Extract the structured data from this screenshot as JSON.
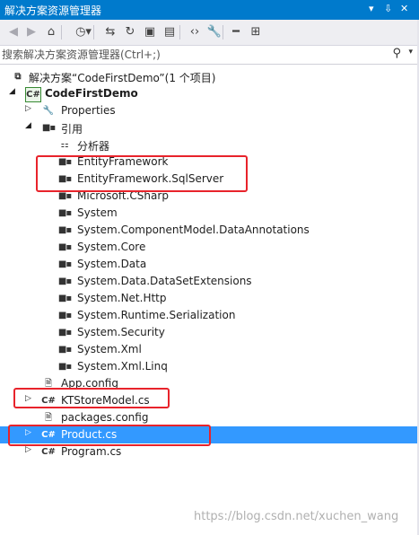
{
  "panel": {
    "title": "解决方案资源管理器",
    "controls": {
      "dropdown": "▾",
      "pin": "⇩",
      "close": "✕"
    }
  },
  "toolbar": {
    "buttons": [
      {
        "name": "back-button",
        "icon": "◀",
        "dim": true
      },
      {
        "name": "forward-button",
        "icon": "▶",
        "dim": true
      },
      {
        "name": "home-button",
        "icon": "⌂"
      },
      {
        "name": "pending-changes-button",
        "icon": "◷▾"
      },
      {
        "name": "sync-button",
        "icon": "⇆"
      },
      {
        "name": "refresh-button",
        "icon": "↻"
      },
      {
        "name": "collapse-all-button",
        "icon": "▣"
      },
      {
        "name": "show-all-files-button",
        "icon": "▤"
      },
      {
        "name": "view-code-button",
        "icon": "‹›"
      },
      {
        "name": "properties-button",
        "icon": "🔧"
      },
      {
        "name": "preview-button",
        "icon": "━"
      },
      {
        "name": "class-diagram-button",
        "icon": "⊞"
      }
    ]
  },
  "search": {
    "placeholder": "搜索解决方案资源管理器(Ctrl+;)",
    "search_icon": "⚲",
    "dropdown_icon": "▾"
  },
  "tree": {
    "rows": [
      {
        "label": "解决方案“CodeFirstDemo”(1 个项目)",
        "icon": "solution",
        "arrow": "",
        "bold": false
      },
      {
        "label": "CodeFirstDemo",
        "icon": "project",
        "arrow": "down",
        "bold": true
      },
      {
        "label": "Properties",
        "icon": "wrench",
        "arrow": "right",
        "bold": false
      },
      {
        "label": "引用",
        "icon": "ref",
        "arrow": "down",
        "bold": false
      },
      {
        "label": "分析器",
        "icon": "analyzer",
        "arrow": "",
        "bold": false
      },
      {
        "label": "EntityFramework",
        "icon": "ref",
        "arrow": "",
        "bold": false
      },
      {
        "label": "EntityFramework.SqlServer",
        "icon": "ref",
        "arrow": "",
        "bold": false
      },
      {
        "label": "Microsoft.CSharp",
        "icon": "ref",
        "arrow": "",
        "bold": false
      },
      {
        "label": "System",
        "icon": "ref",
        "arrow": "",
        "bold": false
      },
      {
        "label": "System.ComponentModel.DataAnnotations",
        "icon": "ref",
        "arrow": "",
        "bold": false
      },
      {
        "label": "System.Core",
        "icon": "ref",
        "arrow": "",
        "bold": false
      },
      {
        "label": "System.Data",
        "icon": "ref",
        "arrow": "",
        "bold": false
      },
      {
        "label": "System.Data.DataSetExtensions",
        "icon": "ref",
        "arrow": "",
        "bold": false
      },
      {
        "label": "System.Net.Http",
        "icon": "ref",
        "arrow": "",
        "bold": false
      },
      {
        "label": "System.Runtime.Serialization",
        "icon": "ref",
        "arrow": "",
        "bold": false
      },
      {
        "label": "System.Security",
        "icon": "ref",
        "arrow": "",
        "bold": false
      },
      {
        "label": "System.Xml",
        "icon": "ref",
        "arrow": "",
        "bold": false
      },
      {
        "label": "System.Xml.Linq",
        "icon": "ref",
        "arrow": "",
        "bold": false
      },
      {
        "label": "App.config",
        "icon": "file",
        "arrow": "",
        "bold": false
      },
      {
        "label": "KTStoreModel.cs",
        "icon": "cs",
        "arrow": "right",
        "bold": false
      },
      {
        "label": "packages.config",
        "icon": "file",
        "arrow": "",
        "bold": false
      },
      {
        "label": "Product.cs",
        "icon": "cs",
        "arrow": "right",
        "bold": false,
        "selected": true
      },
      {
        "label": "Program.cs",
        "icon": "cs",
        "arrow": "right",
        "bold": false
      }
    ]
  },
  "icon_glyphs": {
    "solution": "⧉",
    "project": "C#",
    "cs": "C#",
    "ref": "■▪",
    "wrench": "🔧",
    "analyzer": "⚏",
    "file": "🗎"
  },
  "colors": {
    "titlebar": "#007acc",
    "selection": "#3399ff",
    "highlight_box": "#e8232b"
  },
  "watermark": "https://blog.csdn.net/xuchen_wang"
}
